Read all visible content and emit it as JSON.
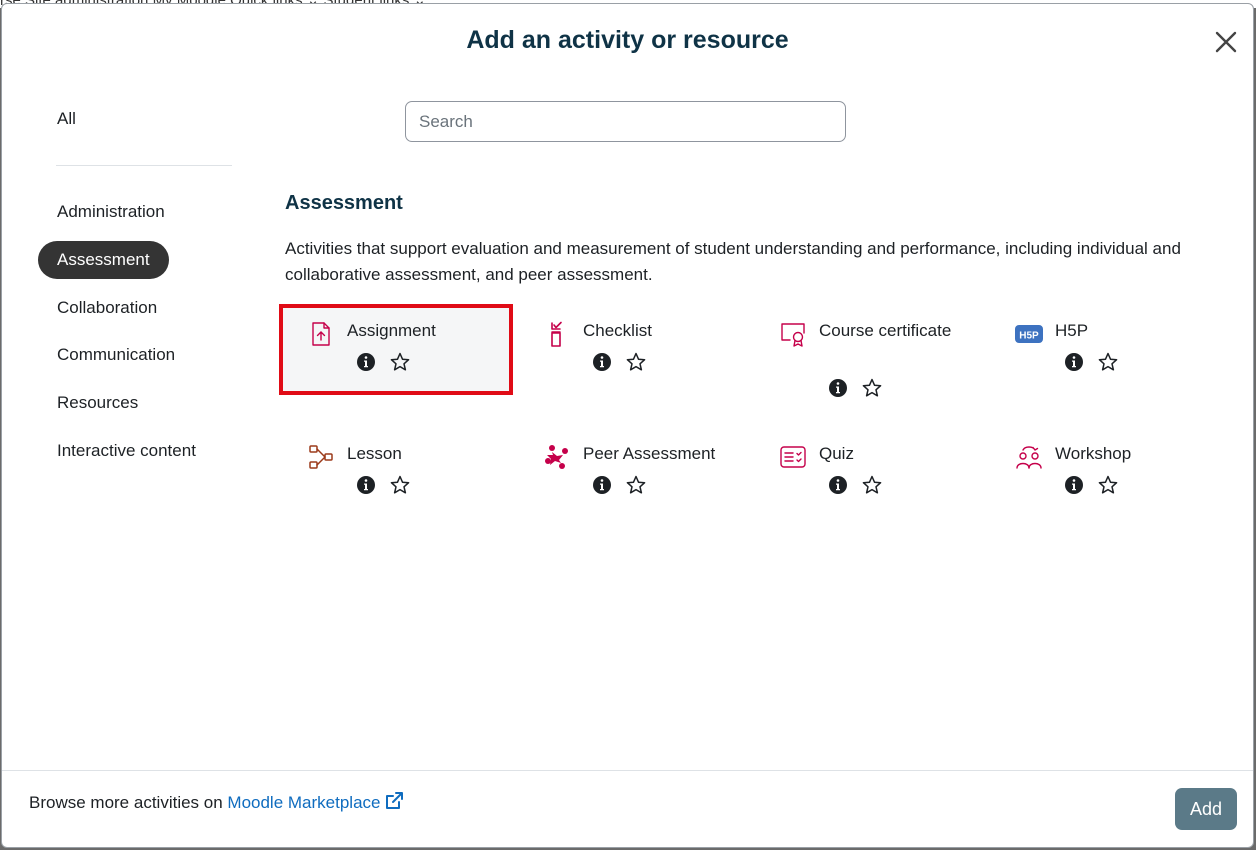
{
  "background": {
    "nav_text": "rse    Site administration    My Moodle    Quick links ⌄    Student links ⌄"
  },
  "modal": {
    "title": "Add an activity or resource",
    "close_icon": "close-icon"
  },
  "sidebar": {
    "items": [
      {
        "label": "All",
        "active": false
      },
      {
        "label": "Administration",
        "active": false
      },
      {
        "label": "Assessment",
        "active": true
      },
      {
        "label": "Collaboration",
        "active": false
      },
      {
        "label": "Communication",
        "active": false
      },
      {
        "label": "Resources",
        "active": false
      },
      {
        "label": "Interactive content",
        "active": false
      }
    ]
  },
  "search": {
    "placeholder": "Search",
    "value": ""
  },
  "section": {
    "title": "Assessment",
    "description": "Activities that support evaluation and measurement of student understanding and performance, including individual and collaborative assessment, and peer assessment."
  },
  "activities": [
    {
      "name": "Assignment",
      "icon": "assignment-icon",
      "selected": true
    },
    {
      "name": "Checklist",
      "icon": "checklist-icon",
      "selected": false
    },
    {
      "name": "Course certificate",
      "icon": "certificate-icon",
      "selected": false
    },
    {
      "name": "H5P",
      "icon": "h5p-icon",
      "selected": false
    },
    {
      "name": "Lesson",
      "icon": "lesson-icon",
      "selected": false
    },
    {
      "name": "Peer Assessment",
      "icon": "peer-assessment-icon",
      "selected": false
    },
    {
      "name": "Quiz",
      "icon": "quiz-icon",
      "selected": false
    },
    {
      "name": "Workshop",
      "icon": "workshop-icon",
      "selected": false
    }
  ],
  "footer": {
    "browse_text": "Browse more activities on ",
    "marketplace_link": "Moodle Marketplace",
    "add_label": "Add"
  },
  "colors": {
    "heading": "#0f3346",
    "assessment_icon": "#c5004a",
    "lesson_icon": "#9c3a1a",
    "h5p_badge": "#3d72c0",
    "selection_outline": "#e00b16",
    "link": "#0f6cbf",
    "add_button": "#5b7a88",
    "active_nav": "#343434"
  }
}
